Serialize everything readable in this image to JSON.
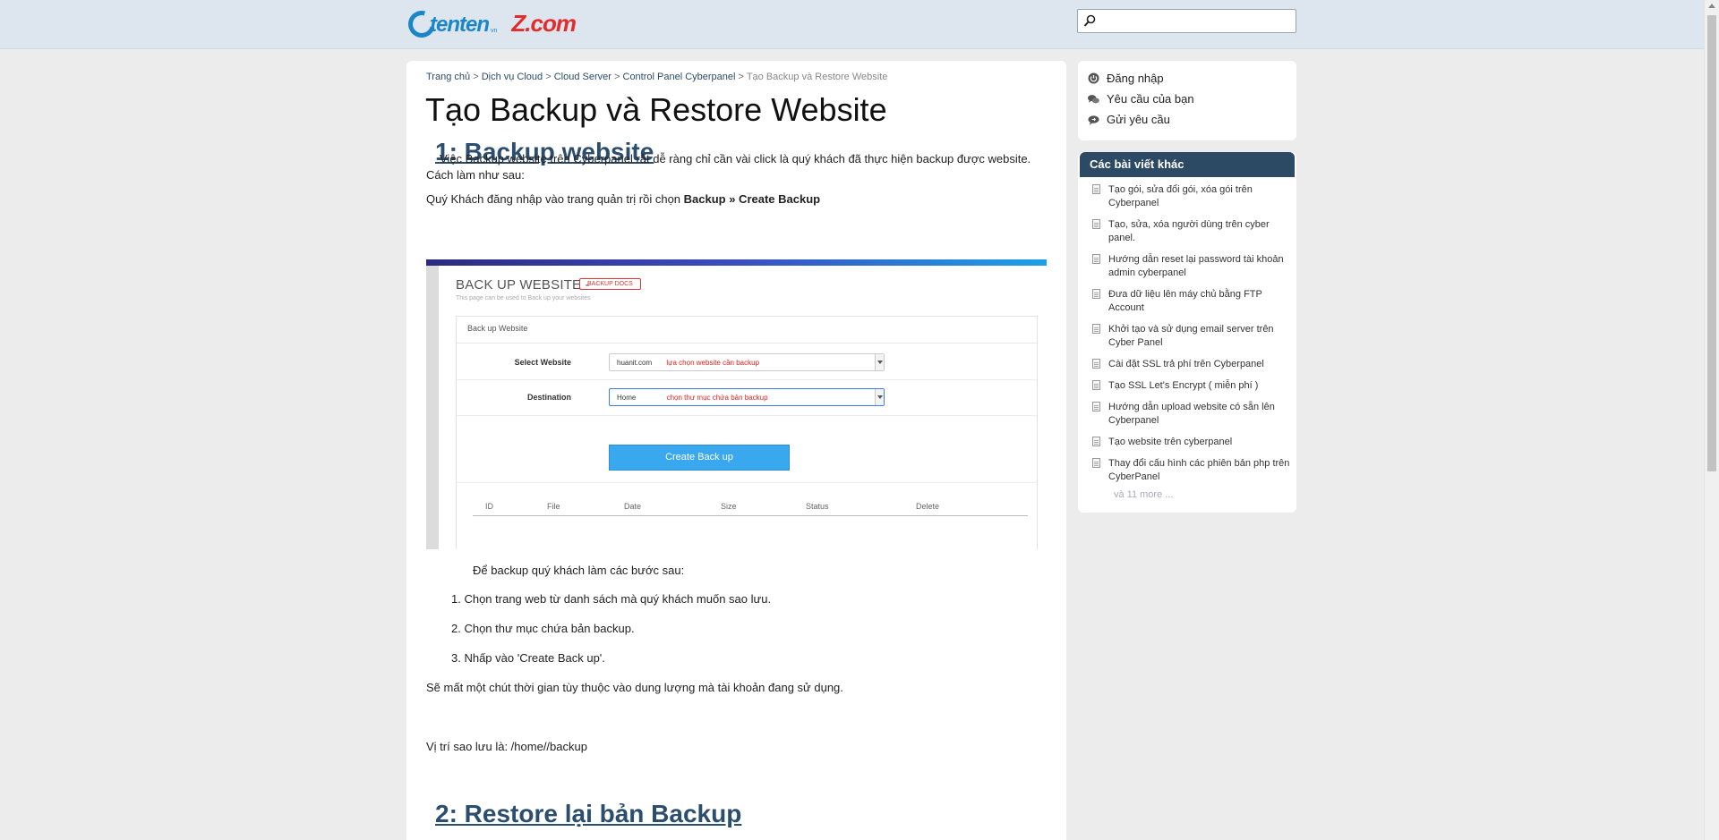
{
  "header": {
    "logo_tenten": "tenten",
    "logo_tenten_suffix": "vn",
    "logo_tenten_sub": "TÊN MIỀN & WEB HOSTING",
    "logo_zcom": "Z.com",
    "search_placeholder": ""
  },
  "breadcrumb": {
    "items": [
      "Trang chủ",
      "Dịch vụ Cloud",
      "Cloud Server",
      "Control Panel Cyberpanel"
    ],
    "separator": ">",
    "current": "Tạo Backup và Restore Website"
  },
  "article": {
    "title": "Tạo Backup và Restore Website",
    "section1_heading": "1: Backup website",
    "intro_line1": "Việc Backup website trên Cyberpanel rất dễ ràng chỉ cần vài click là quý khách đã thực hiện backup được website.",
    "intro_line2": "Cách làm như sau:",
    "login_text": "Quý Khách đăng nhập vào trang quản trị rồi chọn ",
    "login_bold": "Backup » Create Backup",
    "steps_intro": "Để backup quý khách làm các bước sau:",
    "steps": [
      "1. Chọn trang web từ danh sách mà quý khách muốn sao lưu.",
      "2. Chọn thư mục chứa bản backup.",
      "3. Nhấp vào 'Create Back up'."
    ],
    "time_note": "Sẽ mất một chút thời gian tùy thuộc vào dung lượng mà tài khoản đang sử dụng.",
    "location": "Vị trí sao lưu là: /home//backup",
    "section2_heading": "2: Restore lại bản Backup"
  },
  "screenshot": {
    "title": "BACK UP WEBSITE -",
    "docs_badge": "BACKUP DOCS",
    "subtitle": "This page can be used to Back up your websites",
    "panel_title": "Back up Website",
    "select_website_label": "Select Website",
    "select_website_value": "huanit.com",
    "select_website_hint": "lựa chọn website cần backup",
    "destination_label": "Destination",
    "destination_value": "Home",
    "destination_hint": "chọn thư mục chứa bản backup",
    "create_button": "Create Back up",
    "columns": [
      "ID",
      "File",
      "Date",
      "Size",
      "Status",
      "Delete"
    ]
  },
  "sidebar": {
    "links": [
      {
        "label": "Đăng nhập",
        "icon": "power-icon"
      },
      {
        "label": "Yêu cầu của bạn",
        "icon": "chat-icon"
      },
      {
        "label": "Gửi yêu cầu",
        "icon": "send-icon"
      }
    ],
    "other_articles_title": "Các bài viết khác",
    "articles": [
      {
        "line1": "Tạo gói, sửa đổi gói, xóa gói trên",
        "line2": "Cyberpanel"
      },
      {
        "line1": "Tạo, sửa, xóa người dùng trên cyber",
        "line2": "panel."
      },
      {
        "line1": "Hướng dẫn reset lại password tài khoản",
        "line2": "admin cyberpanel"
      },
      {
        "line1": "Đưa dữ liệu lên máy chủ bằng FTP",
        "line2": "Account"
      },
      {
        "line1": "Khởi tạo và sử dụng email server trên",
        "line2": "Cyber Panel"
      },
      {
        "line1": "Cài đặt SSL trả phí trên Cyberpanel",
        "line2": ""
      },
      {
        "line1": "Tạo SSL Let's Encrypt ( miễn phí )",
        "line2": ""
      },
      {
        "line1": "Hướng dẫn upload website có sẵn lên",
        "line2": "Cyberpanel"
      },
      {
        "line1": "Tạo website trên cyberpanel",
        "line2": ""
      },
      {
        "line1": "Thay đổi cấu hình các phiên bản php trên",
        "line2": "CyberPanel"
      }
    ],
    "more": "và 11 more ..."
  },
  "colors": {
    "header_bg": "#dde6ee",
    "heading_blue": "#2c4e6e",
    "sidebar_head": "#2c4a63",
    "page_bg": "#ececec"
  }
}
